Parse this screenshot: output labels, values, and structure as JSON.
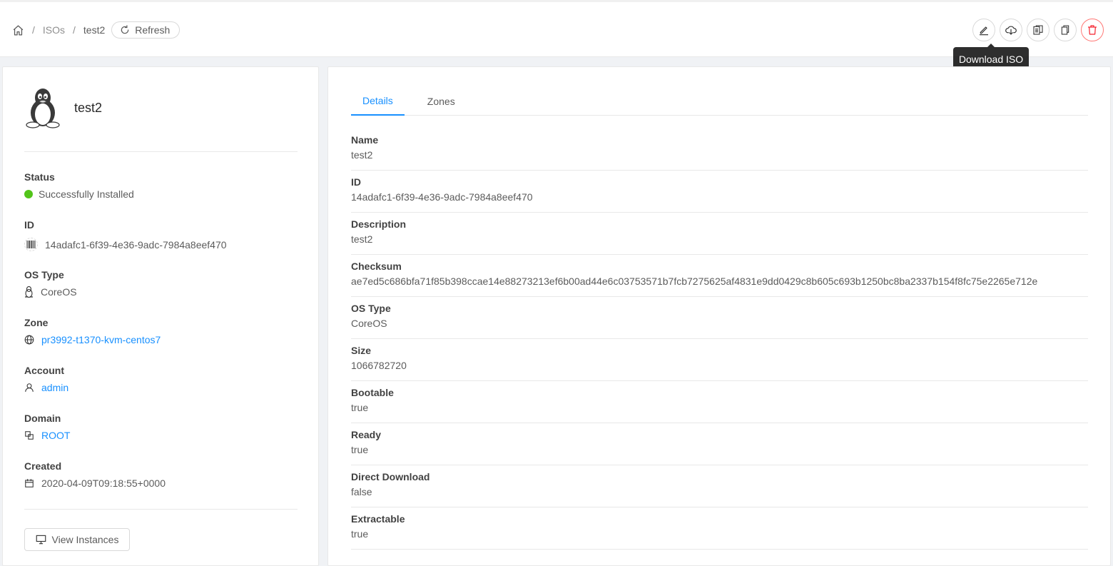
{
  "breadcrumb": {
    "parent": "ISOs",
    "current": "test2",
    "separator": "/",
    "refresh_label": "Refresh"
  },
  "toolbar": {
    "actions": [
      {
        "icon": "edit-icon"
      },
      {
        "icon": "cloud-download-icon"
      },
      {
        "icon": "copy-to-zone-icon"
      },
      {
        "icon": "copy-icon"
      },
      {
        "icon": "delete-icon"
      }
    ],
    "tooltip": "Download ISO"
  },
  "resource": {
    "name": "test2",
    "fields": {
      "status": {
        "label": "Status",
        "value": "Successfully Installed",
        "color": "#52c41a"
      },
      "id": {
        "label": "ID",
        "value": "14adafc1-6f39-4e36-9adc-7984a8eef470"
      },
      "ostype": {
        "label": "OS Type",
        "value": "CoreOS"
      },
      "zone": {
        "label": "Zone",
        "value": "pr3992-t1370-kvm-centos7"
      },
      "account": {
        "label": "Account",
        "value": "admin"
      },
      "domain": {
        "label": "Domain",
        "value": "ROOT"
      },
      "created": {
        "label": "Created",
        "value": "2020-04-09T09:18:55+0000"
      }
    },
    "view_instances_label": "View Instances"
  },
  "tabs": [
    {
      "label": "Details",
      "active": true
    },
    {
      "label": "Zones",
      "active": false
    }
  ],
  "details": [
    {
      "label": "Name",
      "value": "test2"
    },
    {
      "label": "ID",
      "value": "14adafc1-6f39-4e36-9adc-7984a8eef470"
    },
    {
      "label": "Description",
      "value": "test2"
    },
    {
      "label": "Checksum",
      "value": "ae7ed5c686bfa71f85b398ccae14e88273213ef6b00ad44e6c03753571b7fcb7275625af4831e9dd0429c8b605c693b1250bc8ba2337b154f8fc75e2265e712e"
    },
    {
      "label": "OS Type",
      "value": "CoreOS"
    },
    {
      "label": "Size",
      "value": "1066782720"
    },
    {
      "label": "Bootable",
      "value": "true"
    },
    {
      "label": "Ready",
      "value": "true"
    },
    {
      "label": "Direct Download",
      "value": "false"
    },
    {
      "label": "Extractable",
      "value": "true"
    }
  ],
  "colors": {
    "link": "#1890ff",
    "danger": "#f5222d",
    "success": "#52c41a"
  }
}
